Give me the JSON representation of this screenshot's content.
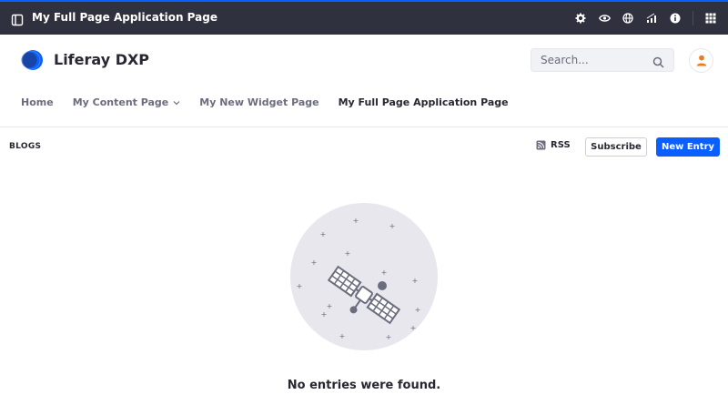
{
  "control_menu": {
    "title": "My Full Page Application Page",
    "icons": [
      "sidebar-toggle-icon",
      "gear-icon",
      "eye-icon",
      "globe-icon",
      "analytics-icon",
      "info-icon",
      "grid-icon"
    ]
  },
  "header": {
    "site_name": "Liferay DXP",
    "search_placeholder": "Search...",
    "brand_color": "#0b5fff",
    "avatar_color": "#ec7d1e"
  },
  "nav": {
    "items": [
      {
        "label": "Home",
        "active": false
      },
      {
        "label": "My Content Page",
        "active": false,
        "has_dropdown": true
      },
      {
        "label": "My New Widget Page",
        "active": false
      },
      {
        "label": "My Full Page Application Page",
        "active": true
      }
    ]
  },
  "portlet": {
    "title": "BLOGS",
    "rss_label": "RSS",
    "subscribe_label": "Subscribe",
    "new_entry_label": "New Entry",
    "empty_message": "No entries were found."
  }
}
